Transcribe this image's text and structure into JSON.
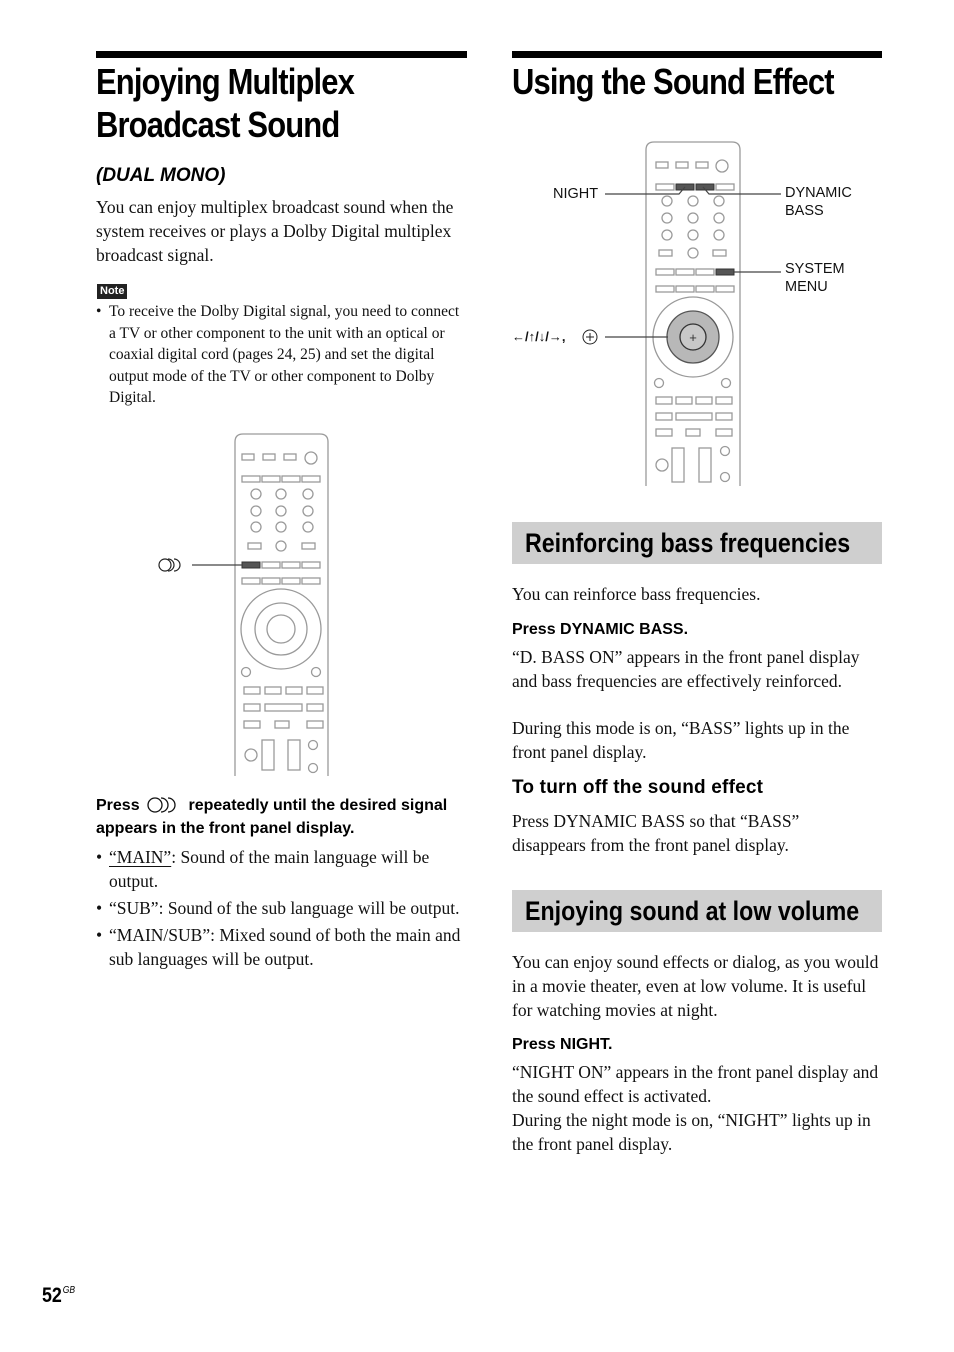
{
  "left": {
    "title_line1": "Enjoying Multiplex",
    "title_line2": "Broadcast Sound",
    "subtitle": "(DUAL MONO)",
    "intro": "You can enjoy multiplex broadcast sound when the system receives or plays a Dolby Digital multiplex broadcast signal.",
    "note_label": "Note",
    "note_text": "To receive the Dolby Digital signal, you need to connect a TV or other component to the unit with an optical or coaxial digital cord (pages 24, 25) and set the digital output mode of the TV or other component to Dolby Digital.",
    "remote_callout_icon": "audio-dual-mono-icon",
    "instruction_prefix": "Press",
    "instruction_suffix": "repeatedly until the desired signal appears in the front panel display.",
    "bullets": [
      {
        "key": "“MAIN”",
        "text": ": Sound of the main language will be output."
      },
      {
        "key": "“SUB”",
        "text": ": Sound of the sub language will be output."
      },
      {
        "key": "“MAIN/SUB”",
        "text": ": Mixed sound of both the main and sub languages will be output."
      }
    ]
  },
  "right": {
    "title": "Using the Sound Effect",
    "remote_labels": {
      "night": "NIGHT",
      "dynamic_bass_1": "DYNAMIC",
      "dynamic_bass_2": "BASS",
      "system_menu_1": "SYSTEM",
      "system_menu_2": "MENU",
      "arrows": "←/↑/↓/→,"
    },
    "section1": {
      "title": "Reinforcing bass frequencies",
      "intro": "You can reinforce bass frequencies.",
      "step": "Press DYNAMIC BASS.",
      "result": "“D. BASS ON” appears in the front panel display and bass frequencies are effectively reinforced.",
      "result2": "During this mode is on, “BASS” lights up in the front panel display.",
      "subheading": "To turn off the sound effect",
      "off_text": "Press DYNAMIC BASS so that “BASS” disappears from the front panel display."
    },
    "section2": {
      "title": "Enjoying sound at low volume",
      "intro": "You can enjoy sound effects or dialog, as you would in a movie theater, even at low volume. It is useful for watching movies at night.",
      "step": "Press NIGHT.",
      "result": "“NIGHT ON” appears in the front panel display and the sound effect is activated.",
      "result2": "During the night mode is on, “NIGHT” lights up in the front panel display."
    }
  },
  "footer": {
    "page_number": "52",
    "page_suffix": "GB"
  },
  "colors": {
    "band_bg": "#cfcfcf",
    "remote_outline": "#9a9a9a",
    "highlight_button": "#555555"
  }
}
